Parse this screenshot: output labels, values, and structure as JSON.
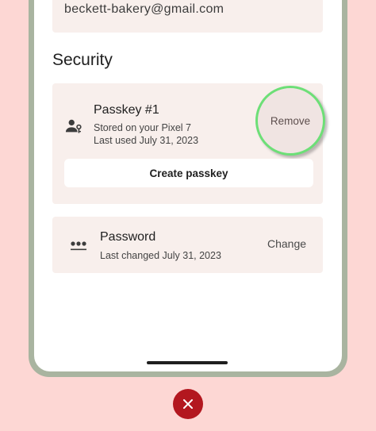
{
  "account": {
    "email": "beckett-bakery@gmail.com"
  },
  "security": {
    "title": "Security",
    "passkey": {
      "name": "Passkey #1",
      "stored": "Stored on your Pixel 7",
      "last_used": "Last used July 31, 2023",
      "remove_label": "Remove",
      "icon": "passkey-person-icon"
    },
    "create_passkey_label": "Create passkey",
    "password": {
      "name": "Password",
      "last_changed": "Last changed July 31, 2023",
      "change_label": "Change",
      "icon": "password-dots-icon"
    }
  },
  "colors": {
    "background": "#fdd7d4",
    "card": "#f8efec",
    "highlight_ring": "#6ddf77",
    "error_badge": "#b3171f"
  },
  "overlay": {
    "icon": "close-icon"
  }
}
